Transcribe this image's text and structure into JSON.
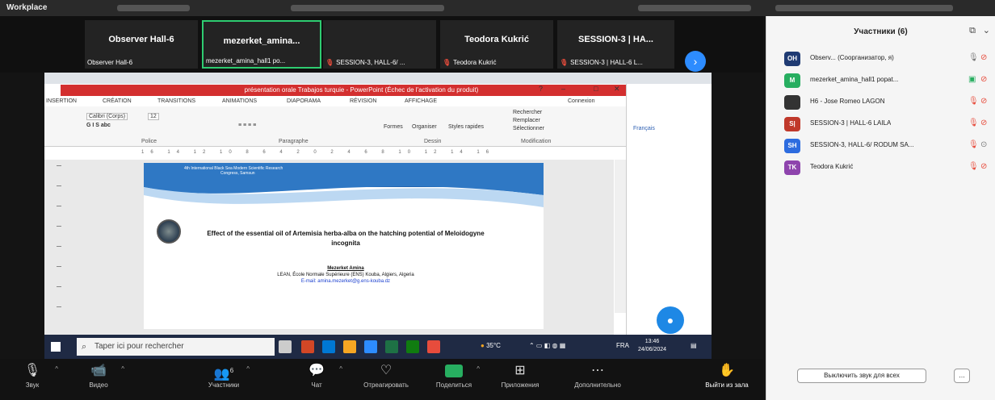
{
  "window": {
    "app_name": "Workplace"
  },
  "thumbnails": [
    {
      "name": "Observer Hall-6",
      "label": "Observer Hall-6",
      "muted": false
    },
    {
      "name": "mezerket_amina...",
      "label": "mezerket_amina_hall1 po...",
      "muted": false
    },
    {
      "name": "",
      "label": "SESSION-3, HALL-6/ ...",
      "muted": true
    },
    {
      "name": "Teodora Kukrić",
      "label": "Teodora Kukrić",
      "muted": true
    },
    {
      "name": "SESSION-3 | HA...",
      "label": "SESSION-3 | HALL-6 L...",
      "muted": true
    }
  ],
  "next_icon": "›",
  "ppt": {
    "title": "présentation orale Trabajos turquie - PowerPoint (Échec de l'activation du produit)",
    "tabs": [
      "INSERTION",
      "CRÉATION",
      "TRANSITIONS",
      "ANIMATIONS",
      "DIAPORAMA",
      "RÉVISION",
      "AFFICHAGE"
    ],
    "account": "Connexion",
    "font_name": "Calibri (Corps)",
    "font_size": "12",
    "groups": [
      "Police",
      "Paragraphe",
      "Dessin",
      "Modification"
    ],
    "ribbon_items": [
      "Formes",
      "Organiser",
      "Styles rapides",
      "Rechercher",
      "Remplacer",
      "Sélectionner"
    ],
    "ruler": "16 14 12 10 8 6 4 2 0 2 4 6 8 10 12 14 16",
    "side_lang": "Français",
    "slide": {
      "header1": "4th International Black Sea Modern Scientific Research",
      "header2": "Congress, Samsun",
      "title": "Effect of the essential oil of Artemisia herba-alba on the hatching potential of Meloidogyne incognita",
      "author": "Mezerket Amina",
      "affiliation": "LEAN, École Normale Supérieure (ENS) Kouba, Algiers, Algeria",
      "email": "E-mail: amina.mezerket@g.ens-kouba.dz"
    }
  },
  "taskbar": {
    "search_placeholder": "Taper ici pour rechercher",
    "weather": "35°C",
    "lang": "FRA",
    "time": "13:46",
    "date": "24/06/2024"
  },
  "toolbar": [
    {
      "icon": "🎙",
      "label": "Звук",
      "caret": true
    },
    {
      "icon": "📹",
      "label": "Видео",
      "caret": true
    },
    {
      "icon": "👥",
      "label": "Участники",
      "badge": "6",
      "caret": true
    },
    {
      "icon": "💬",
      "label": "Чат",
      "caret": true
    },
    {
      "icon": "♡",
      "label": "Отреагировать",
      "caret": false
    },
    {
      "icon": "↑",
      "label": "Поделиться",
      "caret": true
    },
    {
      "icon": "⊞",
      "label": "Приложения",
      "caret": false
    },
    {
      "icon": "⋯",
      "label": "Дополнительно",
      "caret": false
    },
    {
      "icon": "✋",
      "label": "Выйти из зала",
      "caret": false
    }
  ],
  "participants_panel": {
    "title": "Участники (6)",
    "popout_icon": "⧉",
    "close_icon": "⌄",
    "participants": [
      {
        "initials": "OH",
        "name": "Observ... (Соорганизатор, я)",
        "color": "#1f3b73"
      },
      {
        "initials": "M",
        "name": "mezerket_amina_hall1 popat...",
        "color": "#27ae60"
      },
      {
        "initials": "",
        "name": "H6 - Jose Romeo LAGON",
        "color": "#333333"
      },
      {
        "initials": "S|",
        "name": "SESSION-3 | HALL-6 LAILA",
        "color": "#c0392b"
      },
      {
        "initials": "SH",
        "name": "SESSION-3, HALL-6/ RODUM SA...",
        "color": "#2d6cdf"
      },
      {
        "initials": "TK",
        "name": "Teodora Kukrić",
        "color": "#8e44ad"
      }
    ],
    "mute_all": "Выключить звук для всех",
    "more": "..."
  }
}
